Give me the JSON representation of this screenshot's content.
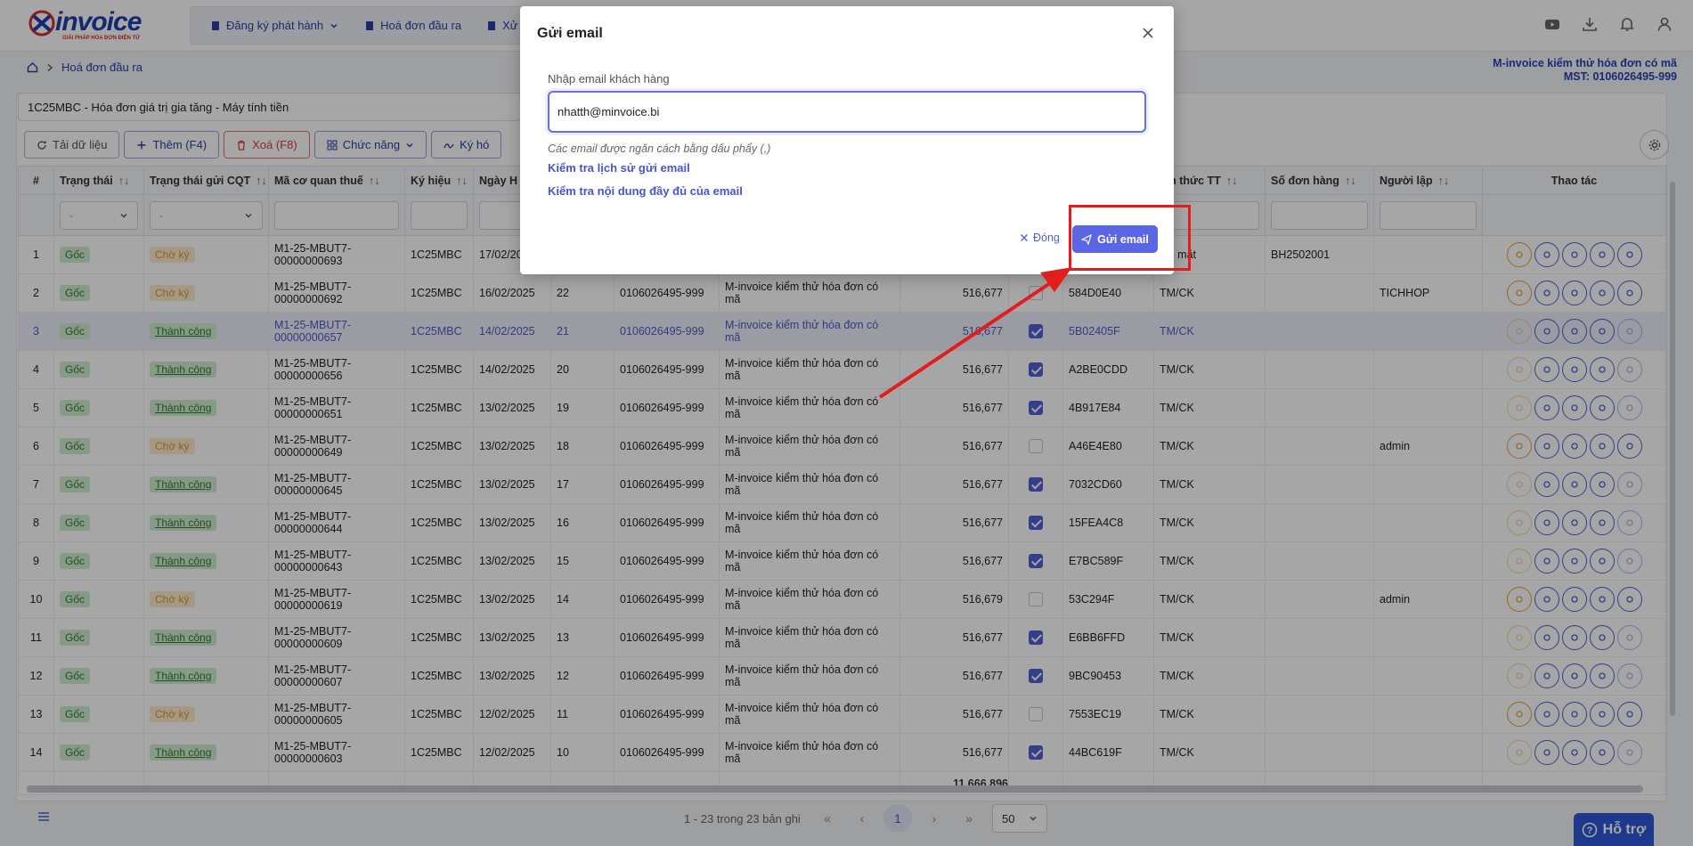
{
  "header": {
    "logo_text": "invoice",
    "logo_tagline": "GIẢI PHÁP HÓA ĐƠN ĐIỆN TỬ",
    "nav": [
      {
        "label": "Đăng ký phát hành"
      },
      {
        "label": "Hoá đơn đầu ra"
      },
      {
        "label": "Xử"
      }
    ]
  },
  "breadcrumb": {
    "page": "Hoá đơn đầu ra"
  },
  "company": {
    "name": "M-invoice kiểm thử hóa đơn có mã",
    "tax_code": "MST: 0106026495-999"
  },
  "series_select": {
    "value": "1C25MBC - Hóa đơn giá trị gia tăng - Máy tính tiền"
  },
  "toolbar": {
    "reload": "Tải dữ liệu",
    "add": "Thêm (F4)",
    "delete": "Xoá (F8)",
    "functions": "Chức năng",
    "sign": "Ký hó"
  },
  "table": {
    "headers": {
      "no": "#",
      "status": "Trạng thái",
      "cqt_status": "Trạng thái gửi CQT",
      "tax_code": "Mã cơ quan thuế",
      "symbol": "Ký hiệu",
      "date": "Ngày H",
      "pay_method": "ình thức TT",
      "order_no": "Số đơn hàng",
      "creator": "Người lập",
      "actions": "Thao tác"
    },
    "filter_placeholder": "-",
    "rows": [
      {
        "no": "1",
        "status": "Gốc",
        "cqt": "Chờ ký",
        "code": "M1-25-MBUT7-00000000693",
        "symbol": "1C25MBC",
        "date": "17/02/2025",
        "inv": "",
        "mst": "",
        "buyer": "",
        "amount": "",
        "checked": false,
        "lookup": "",
        "method": "iền mặt",
        "order": "BH2502001",
        "creator": ""
      },
      {
        "no": "2",
        "status": "Gốc",
        "cqt": "Chờ ký",
        "code": "M1-25-MBUT7-00000000692",
        "symbol": "1C25MBC",
        "date": "16/02/2025",
        "inv": "22",
        "mst": "0106026495-999",
        "buyer": "M-invoice kiểm thử hóa đơn có mã",
        "amount": "516,677",
        "checked": false,
        "lookup": "584D0E40",
        "method": "TM/CK",
        "order": "",
        "creator": "TICHHOP"
      },
      {
        "no": "3",
        "status": "Gốc",
        "cqt": "Thành công",
        "code": "M1-25-MBUT7-00000000657",
        "symbol": "1C25MBC",
        "date": "14/02/2025",
        "inv": "21",
        "mst": "0106026495-999",
        "buyer": "M-invoice kiểm thử hóa đơn có mã",
        "amount": "516,677",
        "checked": true,
        "lookup": "5B02405F",
        "method": "TM/CK",
        "order": "",
        "creator": ""
      },
      {
        "no": "4",
        "status": "Gốc",
        "cqt": "Thành công",
        "code": "M1-25-MBUT7-00000000656",
        "symbol": "1C25MBC",
        "date": "14/02/2025",
        "inv": "20",
        "mst": "0106026495-999",
        "buyer": "M-invoice kiểm thử hóa đơn có mã",
        "amount": "516,677",
        "checked": true,
        "lookup": "A2BE0CDD",
        "method": "TM/CK",
        "order": "",
        "creator": ""
      },
      {
        "no": "5",
        "status": "Gốc",
        "cqt": "Thành công",
        "code": "M1-25-MBUT7-00000000651",
        "symbol": "1C25MBC",
        "date": "13/02/2025",
        "inv": "19",
        "mst": "0106026495-999",
        "buyer": "M-invoice kiểm thử hóa đơn có mã",
        "amount": "516,677",
        "checked": true,
        "lookup": "4B917E84",
        "method": "TM/CK",
        "order": "",
        "creator": ""
      },
      {
        "no": "6",
        "status": "Gốc",
        "cqt": "Chờ ký",
        "code": "M1-25-MBUT7-00000000649",
        "symbol": "1C25MBC",
        "date": "13/02/2025",
        "inv": "18",
        "mst": "0106026495-999",
        "buyer": "M-invoice kiểm thử hóa đơn có mã",
        "amount": "516,677",
        "checked": false,
        "lookup": "A46E4E80",
        "method": "TM/CK",
        "order": "",
        "creator": "admin"
      },
      {
        "no": "7",
        "status": "Gốc",
        "cqt": "Thành công",
        "code": "M1-25-MBUT7-00000000645",
        "symbol": "1C25MBC",
        "date": "13/02/2025",
        "inv": "17",
        "mst": "0106026495-999",
        "buyer": "M-invoice kiểm thử hóa đơn có mã",
        "amount": "516,677",
        "checked": true,
        "lookup": "7032CD60",
        "method": "TM/CK",
        "order": "",
        "creator": ""
      },
      {
        "no": "8",
        "status": "Gốc",
        "cqt": "Thành công",
        "code": "M1-25-MBUT7-00000000644",
        "symbol": "1C25MBC",
        "date": "13/02/2025",
        "inv": "16",
        "mst": "0106026495-999",
        "buyer": "M-invoice kiểm thử hóa đơn có mã",
        "amount": "516,677",
        "checked": true,
        "lookup": "15FEA4C8",
        "method": "TM/CK",
        "order": "",
        "creator": ""
      },
      {
        "no": "9",
        "status": "Gốc",
        "cqt": "Thành công",
        "code": "M1-25-MBUT7-00000000643",
        "symbol": "1C25MBC",
        "date": "13/02/2025",
        "inv": "15",
        "mst": "0106026495-999",
        "buyer": "M-invoice kiểm thử hóa đơn có mã",
        "amount": "516,677",
        "checked": true,
        "lookup": "E7BC589F",
        "method": "TM/CK",
        "order": "",
        "creator": ""
      },
      {
        "no": "10",
        "status": "Gốc",
        "cqt": "Chờ ký",
        "code": "M1-25-MBUT7-00000000619",
        "symbol": "1C25MBC",
        "date": "13/02/2025",
        "inv": "14",
        "mst": "0106026495-999",
        "buyer": "M-invoice kiểm thử hóa đơn có mã",
        "amount": "516,679",
        "checked": false,
        "lookup": "53C294F",
        "method": "TM/CK",
        "order": "",
        "creator": "admin"
      },
      {
        "no": "11",
        "status": "Gốc",
        "cqt": "Thành công",
        "code": "M1-25-MBUT7-00000000609",
        "symbol": "1C25MBC",
        "date": "13/02/2025",
        "inv": "13",
        "mst": "0106026495-999",
        "buyer": "M-invoice kiểm thử hóa đơn có mã",
        "amount": "516,677",
        "checked": true,
        "lookup": "E6BB6FFD",
        "method": "TM/CK",
        "order": "",
        "creator": ""
      },
      {
        "no": "12",
        "status": "Gốc",
        "cqt": "Thành công",
        "code": "M1-25-MBUT7-00000000607",
        "symbol": "1C25MBC",
        "date": "13/02/2025",
        "inv": "12",
        "mst": "0106026495-999",
        "buyer": "M-invoice kiểm thử hóa đơn có mã",
        "amount": "516,677",
        "checked": true,
        "lookup": "9BC90453",
        "method": "TM/CK",
        "order": "",
        "creator": ""
      },
      {
        "no": "13",
        "status": "Gốc",
        "cqt": "Chờ ký",
        "code": "M1-25-MBUT7-00000000605",
        "symbol": "1C25MBC",
        "date": "12/02/2025",
        "inv": "11",
        "mst": "0106026495-999",
        "buyer": "M-invoice kiểm thử hóa đơn có mã",
        "amount": "516,677",
        "checked": false,
        "lookup": "7553EC19",
        "method": "TM/CK",
        "order": "",
        "creator": ""
      },
      {
        "no": "14",
        "status": "Gốc",
        "cqt": "Thành công",
        "code": "M1-25-MBUT7-00000000603",
        "symbol": "1C25MBC",
        "date": "12/02/2025",
        "inv": "10",
        "mst": "0106026495-999",
        "buyer": "M-invoice kiểm thử hóa đơn có mã",
        "amount": "516,677",
        "checked": true,
        "lookup": "44BC619F",
        "method": "TM/CK",
        "order": "",
        "creator": ""
      }
    ],
    "total_amount": "11,666,896"
  },
  "pager": {
    "info": "1 - 23 trong 23 bản ghi",
    "current": "1",
    "page_size": "50"
  },
  "support": {
    "label": "Hỗ trợ"
  },
  "modal": {
    "title": "Gửi email",
    "label": "Nhập email khách hàng",
    "value": "nhatth@minvoice.bi",
    "hint": "Các email được ngăn cách bằng dấu phẩy (,)",
    "link_history": "Kiểm tra lịch sử gửi email",
    "link_content": "Kiểm tra nội dung đầy đủ của email",
    "close_label": "Đóng",
    "send_label": "Gửi email"
  },
  "colors": {
    "accent": "#5a66e6",
    "brand": "#1e40af",
    "highlight": "#e11d1d"
  }
}
